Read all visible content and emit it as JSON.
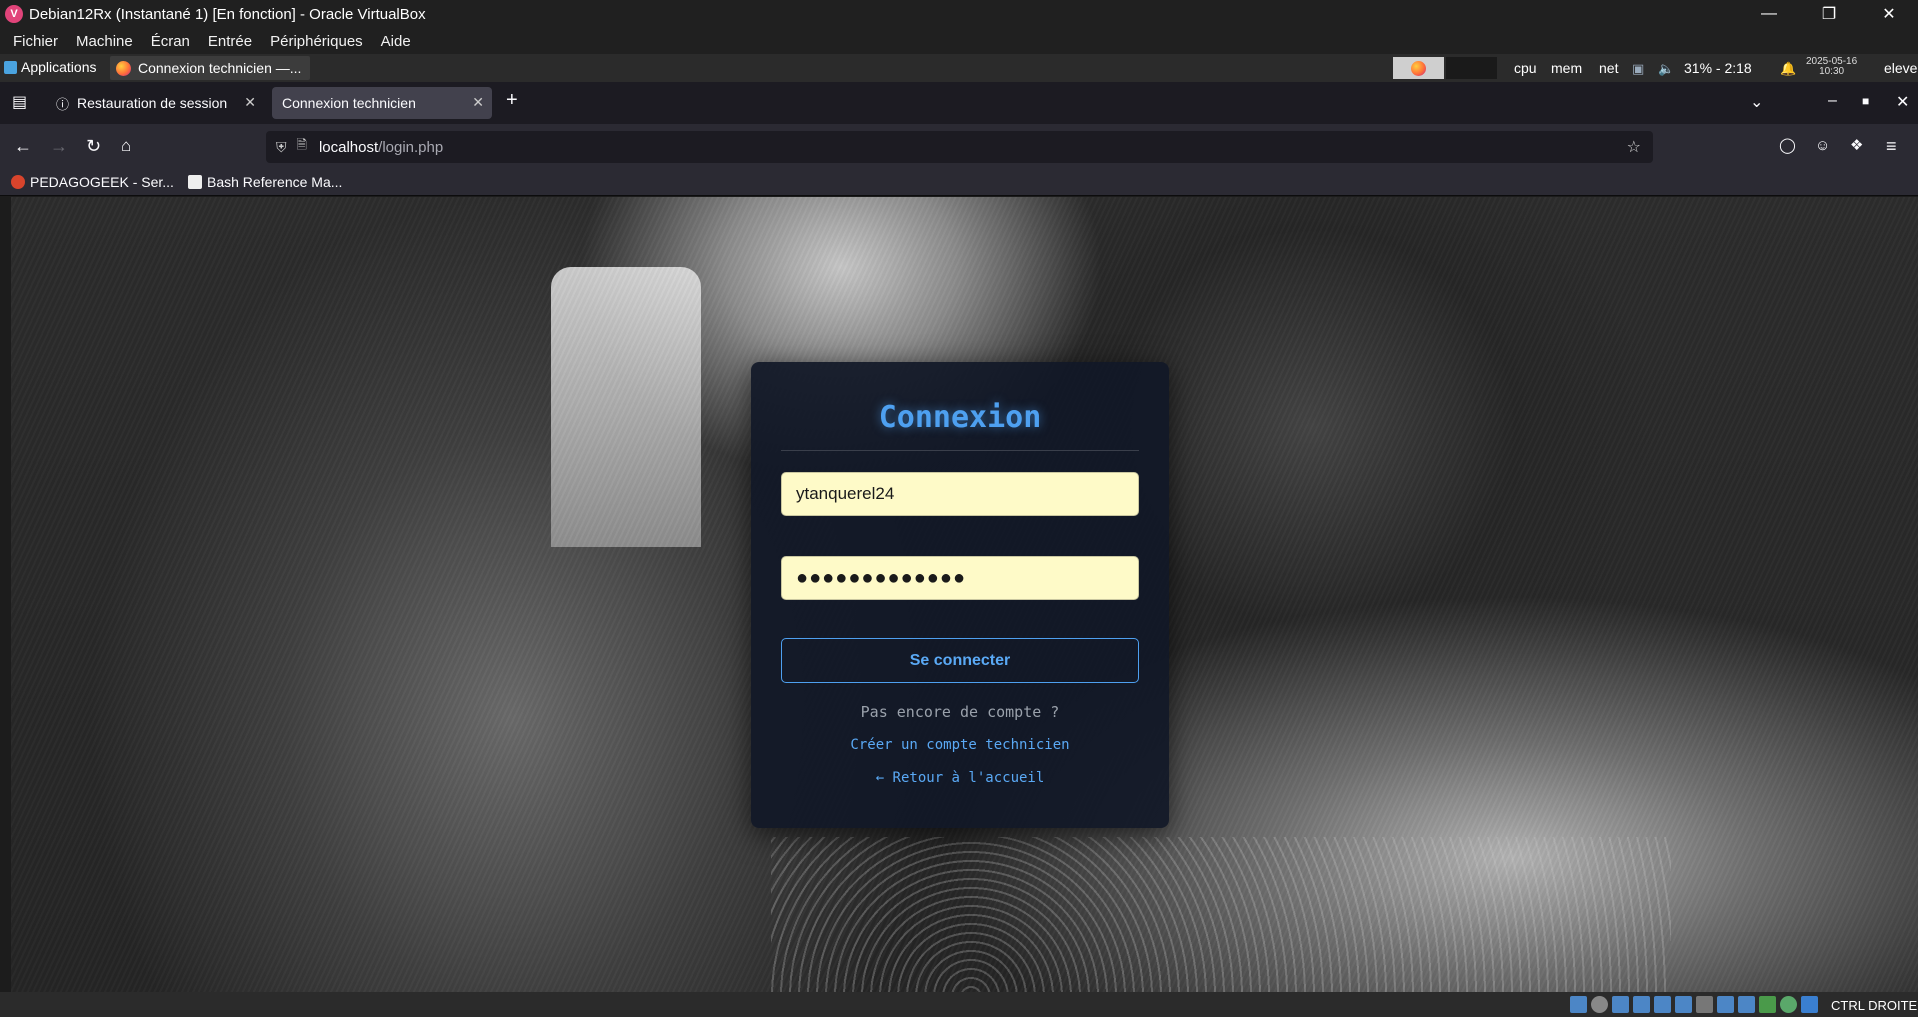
{
  "vbox": {
    "window_title": "Debian12Rx (Instantané 1) [En fonction] - Oracle VirtualBox",
    "menu": [
      "Fichier",
      "Machine",
      "Écran",
      "Entrée",
      "Périphériques",
      "Aide"
    ],
    "host_key": "CTRL DROITE"
  },
  "panel": {
    "applications_label": "Applications",
    "task_label": "Connexion technicien —...",
    "cpu_label": "cpu",
    "mem_label": "mem",
    "net_label": "net",
    "battery_text": "31% - 2:18",
    "date": "2025-05-16",
    "time": "10:30",
    "user": "eleve"
  },
  "browser": {
    "tabs": [
      {
        "label": "Restauration de session",
        "active": false
      },
      {
        "label": "Connexion technicien",
        "active": true
      }
    ],
    "url_host": "localhost",
    "url_path": "/login.php",
    "bookmarks": [
      "PEDAGOGEEK - Ser...",
      "Bash Reference Ma..."
    ]
  },
  "login": {
    "title": "Connexion",
    "username_value": "ytanquerel24",
    "password_mask": "●●●●●●●●●●●●●",
    "submit_label": "Se connecter",
    "no_account_text": "Pas encore de compte ?",
    "register_link": "Créer un compte technicien",
    "home_link": "← Retour à l'accueil"
  },
  "colors": {
    "accent": "#4ea0f0",
    "card_bg": "#111827",
    "field_bg": "#fefac8"
  }
}
